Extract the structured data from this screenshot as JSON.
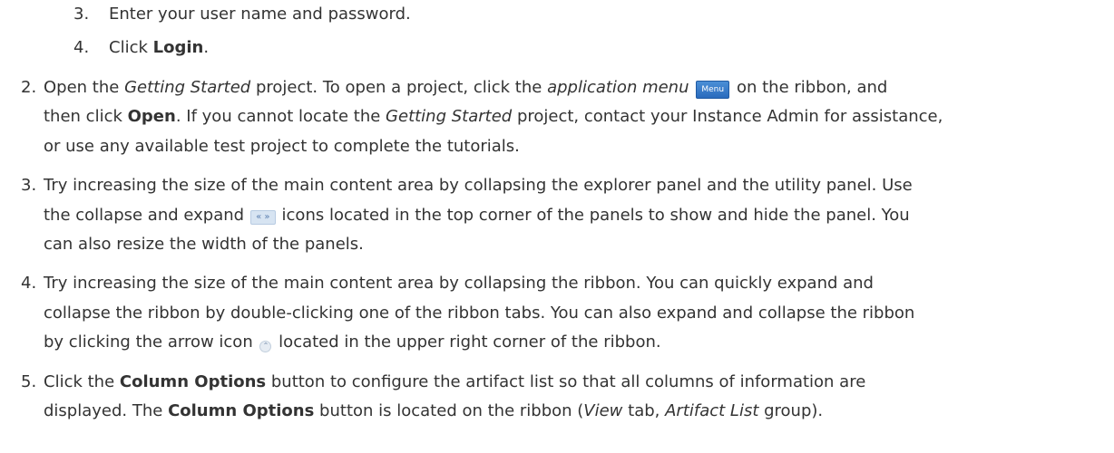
{
  "substeps": [
    {
      "number": "3.",
      "text": "Enter your user name and password."
    },
    {
      "number": "4.",
      "pre": "Click ",
      "bold": "Login",
      "post": "."
    }
  ],
  "steps": {
    "s2": {
      "number": "2.",
      "l1_a": "Open the ",
      "l1_b": "Getting Started",
      "l1_c": " project. To open a project, click the ",
      "l1_d": "application menu",
      "menu_icon_label": "Menu",
      "l1_e": " on the ribbon, and",
      "l2_a": "then click ",
      "l2_b": "Open",
      "l2_c": ". If you cannot locate the ",
      "l2_d": "Getting Started",
      "l2_e": " project, contact your Instance Admin for assistance,",
      "l3": "or use any available test project to complete the tutorials."
    },
    "s3": {
      "number": "3.",
      "l1": "Try increasing the size of the main content area by collapsing the explorer panel and the utility panel. Use",
      "l2_a": "the collapse and expand ",
      "collapse_icon_label": "« »",
      "l2_b": " icons located in the top corner of the panels to show and hide the panel. You",
      "l3": "can also resize the width of the panels."
    },
    "s4": {
      "number": "4.",
      "l1": "Try increasing the size of the main content area by collapsing the ribbon. You can quickly expand and",
      "l2": "collapse the ribbon by double-clicking one of the ribbon tabs. You can also expand and collapse the ribbon",
      "l3_a": "by clicking the arrow icon ",
      "arrow_icon_label": "⌃",
      "l3_b": " located in the upper right corner of the ribbon."
    },
    "s5": {
      "number": "5.",
      "l1_a": "Click the ",
      "l1_b": "Column Options",
      "l1_c": " button to configure the artifact list so that all columns of information are",
      "l2_a": "displayed. The ",
      "l2_b": "Column Options",
      "l2_c": " button is located on the ribbon (",
      "l2_d": "View",
      "l2_e": " tab, ",
      "l2_f": "Artifact List",
      "l2_g": " group)."
    }
  }
}
